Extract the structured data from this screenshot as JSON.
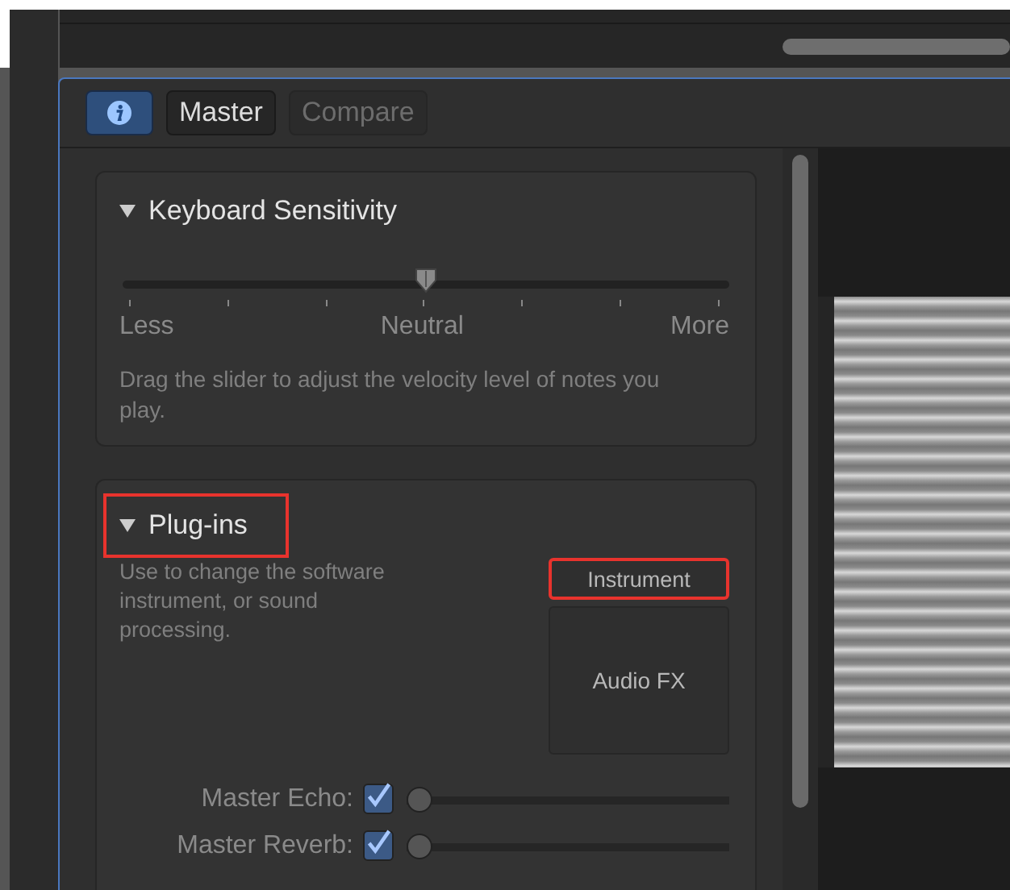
{
  "toolbar": {
    "buttons": [
      {
        "kind": "info",
        "selected": true,
        "disabled": false
      },
      {
        "kind": "text",
        "label": "Master",
        "disabled": false
      },
      {
        "kind": "text",
        "label": "Compare",
        "disabled": true
      }
    ]
  },
  "keyboard_sensitivity": {
    "title": "Keyboard Sensitivity",
    "expanded": true,
    "slider": {
      "level": 0.5,
      "labels": [
        "Less",
        "Neutral",
        "More"
      ]
    },
    "description": "Drag the slider to adjust the velocity level of notes you play."
  },
  "plugins": {
    "title": "Plug-ins",
    "expanded": true,
    "highlighted": true,
    "description": "Use to change the software instrument, or sound processing.",
    "slots": [
      {
        "label": "Instrument",
        "highlighted": true
      },
      {
        "label": "Audio FX",
        "highlighted": false
      }
    ],
    "sends": [
      {
        "label": "Master Echo:",
        "checked": true,
        "level": 0
      },
      {
        "label": "Master Reverb:",
        "checked": true,
        "level": 0
      }
    ]
  }
}
